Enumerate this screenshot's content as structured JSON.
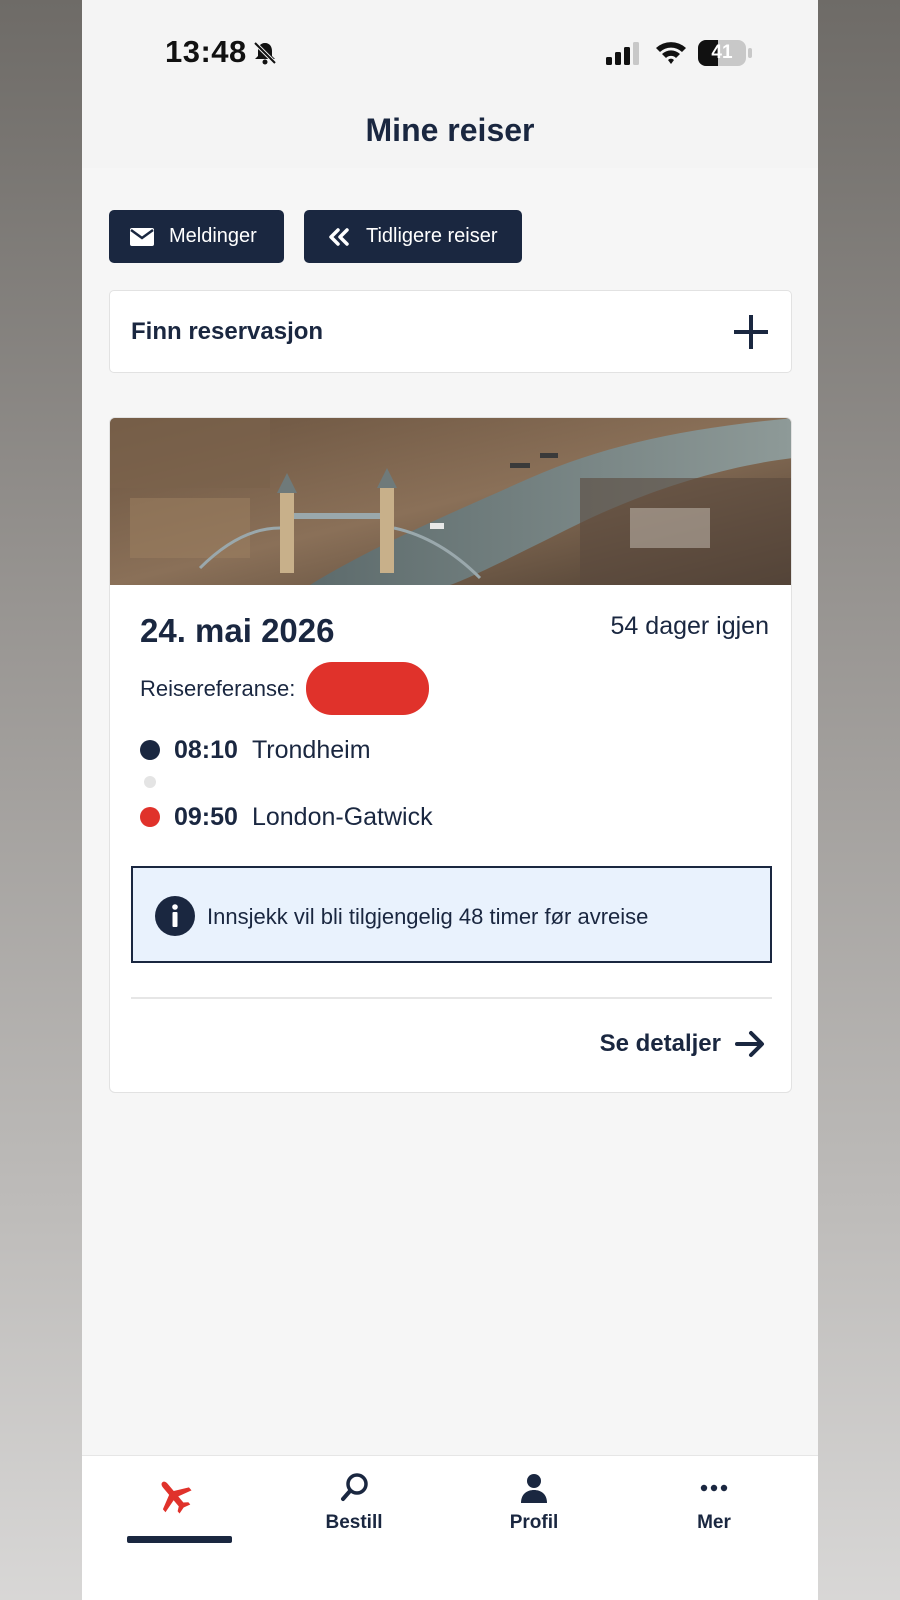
{
  "status_bar": {
    "time": "13:48",
    "battery": "41"
  },
  "header": {
    "title": "Mine reiser"
  },
  "actions": {
    "messages_label": "Meldinger",
    "previous_trips_label": "Tidligere reiser"
  },
  "find_reservation": {
    "label": "Finn reservasjon"
  },
  "trip": {
    "date": "24. mai 2026",
    "days_left": "54 dager igjen",
    "reference_label": "Reisereferanse:",
    "departure": {
      "time": "08:10",
      "city": "Trondheim"
    },
    "arrival": {
      "time": "09:50",
      "city": "London-Gatwick"
    },
    "info": "Innsjekk vil bli tilgjengelig 48 timer før avreise",
    "details_label": "Se detaljer"
  },
  "tabbar": {
    "items": [
      {
        "label": "",
        "icon": "plane-icon",
        "active": true
      },
      {
        "label": "Bestill",
        "icon": "search-icon"
      },
      {
        "label": "Profil",
        "icon": "person-icon"
      },
      {
        "label": "Mer",
        "icon": "more-icon"
      }
    ]
  },
  "colors": {
    "navy": "#1a2740",
    "accent_red": "#e0322b",
    "info_bg": "#e9f2fd",
    "page_bg": "#f6f6f6"
  }
}
